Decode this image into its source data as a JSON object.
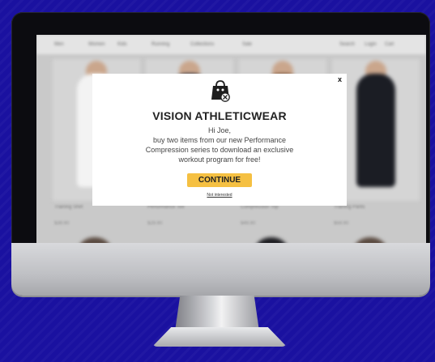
{
  "site": {
    "nav_left": [
      "Men",
      "Women",
      "Kids",
      "Running",
      "Collections",
      "Sale"
    ],
    "nav_right": [
      "Search",
      "Login",
      "Cart"
    ],
    "products": [
      {
        "name": "Training Shirt",
        "price": "$39.90",
        "color": "#f3f3f3"
      },
      {
        "name": "Performance Tee",
        "price": "$29.90",
        "color": "#1f2a3d"
      },
      {
        "name": "Compression Top",
        "price": "$49.90",
        "color": "#6b4a34"
      },
      {
        "name": "Training Pants",
        "price": "$59.90",
        "color": "#1b1d24"
      }
    ]
  },
  "popup": {
    "close_label": "x",
    "logo_icon": "shopping-bag-icon",
    "title": "VISION ATHLETICWEAR",
    "message_lines": [
      "Hi Joe,",
      "buy two items from our new Performance",
      "Compression series to download an exclusive",
      "workout program for free!"
    ],
    "cta_label": "CONTINUE",
    "decline_label": "Not interested"
  },
  "colors": {
    "background": "#1a11a0",
    "cta": "#f5c042",
    "popup": "#ffffff"
  }
}
